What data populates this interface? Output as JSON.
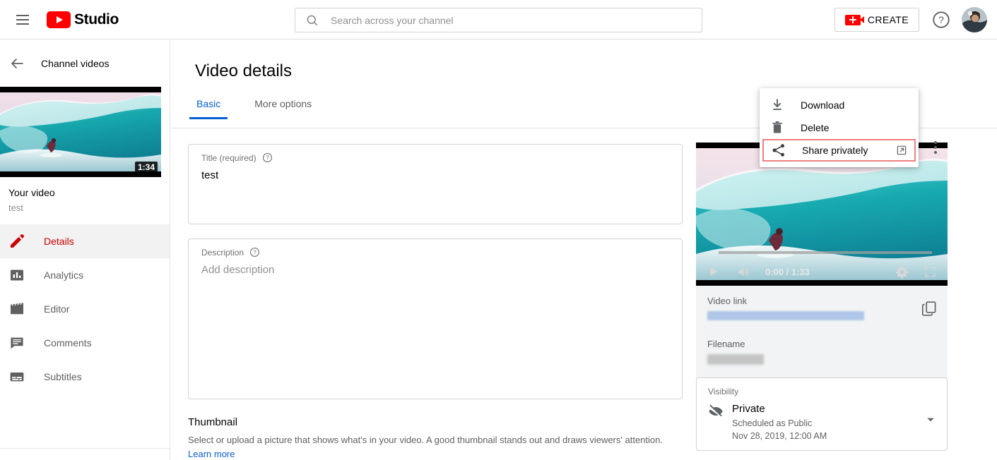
{
  "header": {
    "brand": "Studio",
    "menu_icon": "hamburger-icon",
    "logo_icon": "youtube-logo-icon",
    "search": {
      "placeholder": "Search across your channel",
      "value": "",
      "icon": "search-icon"
    },
    "create_label": "CREATE",
    "create_icon": "video-camera-plus-icon",
    "help_icon": "help-circle-icon",
    "avatar_icon": "user-avatar"
  },
  "sidebar": {
    "back_label": "Channel videos",
    "back_icon": "arrow-left-icon",
    "thumbnail_duration": "1:34",
    "video_title": "Your video",
    "video_subtitle": "test",
    "items": [
      {
        "label": "Details",
        "icon": "pencil-icon",
        "active": true
      },
      {
        "label": "Analytics",
        "icon": "bar-chart-icon",
        "active": false
      },
      {
        "label": "Editor",
        "icon": "clapperboard-icon",
        "active": false
      },
      {
        "label": "Comments",
        "icon": "comment-icon",
        "active": false
      },
      {
        "label": "Subtitles",
        "icon": "subtitles-icon",
        "active": false
      }
    ]
  },
  "main": {
    "page_title": "Video details",
    "tabs": [
      {
        "label": "Basic",
        "active": true
      },
      {
        "label": "More options",
        "active": false
      }
    ],
    "kebab_icon": "more-vertical-icon",
    "menu": {
      "items": [
        {
          "label": "Download",
          "icon": "download-icon",
          "highlighted": false,
          "external": false
        },
        {
          "label": "Delete",
          "icon": "trash-icon",
          "highlighted": false,
          "external": false
        },
        {
          "label": "Share privately",
          "icon": "share-icon",
          "highlighted": true,
          "external": true
        }
      ],
      "highlight_color": "#f08080",
      "external_icon": "external-link-icon"
    },
    "title_field": {
      "label": "Title (required)",
      "value": "test",
      "help_icon": "help-circle-icon"
    },
    "description_field": {
      "label": "Description",
      "value": "",
      "placeholder": "Add description",
      "help_icon": "help-circle-icon"
    },
    "thumbnail": {
      "heading": "Thumbnail",
      "description": "Select or upload a picture that shows what's in your video. A good thumbnail stands out and draws viewers' attention.",
      "link_label": "Learn more"
    }
  },
  "right": {
    "player": {
      "time": "0:00 / 1:33",
      "play_icon": "play-icon",
      "volume_icon": "volume-icon",
      "settings_icon": "gear-icon",
      "fullscreen_icon": "fullscreen-icon"
    },
    "video_link": {
      "label": "Video link",
      "value": "",
      "redacted": true
    },
    "filename": {
      "label": "Filename",
      "value": "",
      "redacted": true
    },
    "copy_icon": "copy-icon",
    "visibility": {
      "label": "Visibility",
      "value": "Private",
      "icon": "eye-off-icon",
      "scheduled_text": "Scheduled as Public",
      "scheduled_date": "Nov 28, 2019, 12:00 AM",
      "caret_icon": "chevron-down-icon"
    }
  },
  "colors": {
    "brand_red": "#ff0000",
    "accent_blue": "#065fd4",
    "active_nav": "#cc0000",
    "highlight": "#f08080"
  }
}
